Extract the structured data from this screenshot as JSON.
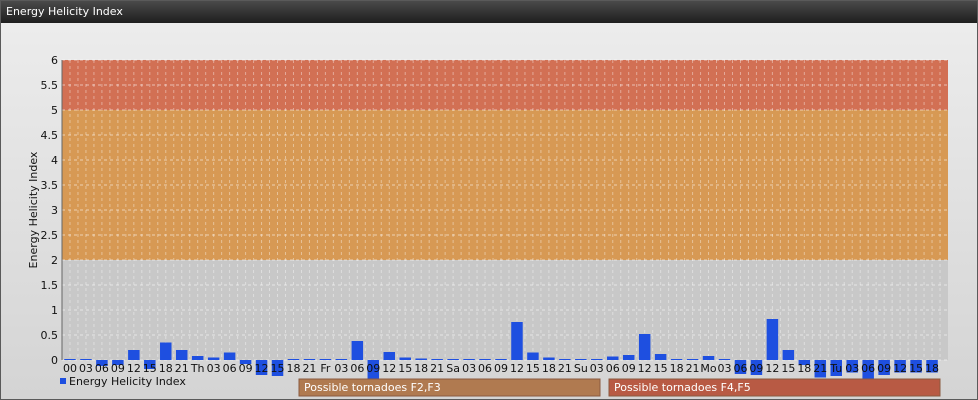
{
  "window": {
    "title": "Energy Helicity Index"
  },
  "chart_data": {
    "type": "bar",
    "ylabel": "Energy Helicity Index",
    "ylim": [
      -0.5,
      6
    ],
    "yticks": [
      "0",
      "0.5",
      "1",
      "1.5",
      "2",
      "2.5",
      "3",
      "3.5",
      "4",
      "4.5",
      "5",
      "5.5",
      "6"
    ],
    "grid": true,
    "x_labels": [
      "00",
      "03",
      "06",
      "09",
      "12",
      "15",
      "18",
      "21",
      "Th",
      "03",
      "06",
      "09",
      "12",
      "15",
      "18",
      "21",
      "Fr",
      "03",
      "06",
      "09",
      "12",
      "15",
      "18",
      "21",
      "Sa",
      "03",
      "06",
      "09",
      "12",
      "15",
      "18",
      "21",
      "Su",
      "03",
      "06",
      "09",
      "12",
      "15",
      "18",
      "21",
      "Mo",
      "03",
      "06",
      "09",
      "12",
      "15",
      "18",
      "21",
      "Tu",
      "03",
      "06",
      "09",
      "12",
      "15",
      "18"
    ],
    "values": [
      0.02,
      0.02,
      -0.12,
      -0.1,
      0.2,
      -0.18,
      0.35,
      0.2,
      0.08,
      0.05,
      0.15,
      -0.08,
      -0.3,
      -0.32,
      0.02,
      0.02,
      0.02,
      0.02,
      0.38,
      -0.45,
      0.16,
      0.05,
      0.03,
      0.02,
      0.02,
      0.02,
      0.02,
      0.02,
      0.76,
      0.15,
      0.05,
      0.02,
      0.02,
      0.02,
      0.07,
      0.1,
      0.52,
      0.12,
      0.02,
      0.02,
      0.08,
      0.02,
      -0.28,
      -0.3,
      0.82,
      0.2,
      -0.1,
      -0.35,
      -0.32,
      -0.25,
      -0.6,
      -0.3,
      -0.25,
      -0.25,
      -0.25
    ],
    "series": [
      {
        "name": "Energy Helicity Index",
        "color": "#1e4fe0"
      }
    ],
    "bands": [
      {
        "from": 2,
        "to": 5,
        "color": "#d99040"
      },
      {
        "from": 5,
        "to": 6,
        "color": "#d46040"
      }
    ],
    "annotations": [
      {
        "text": "Possible tornadoes F2,F3",
        "color": "#b07a50"
      },
      {
        "text": "Possible tornadoes F4,F5",
        "color": "#b85a44"
      }
    ],
    "legend": {
      "position": "bottom-left",
      "label": "Energy Helicity Index"
    }
  }
}
